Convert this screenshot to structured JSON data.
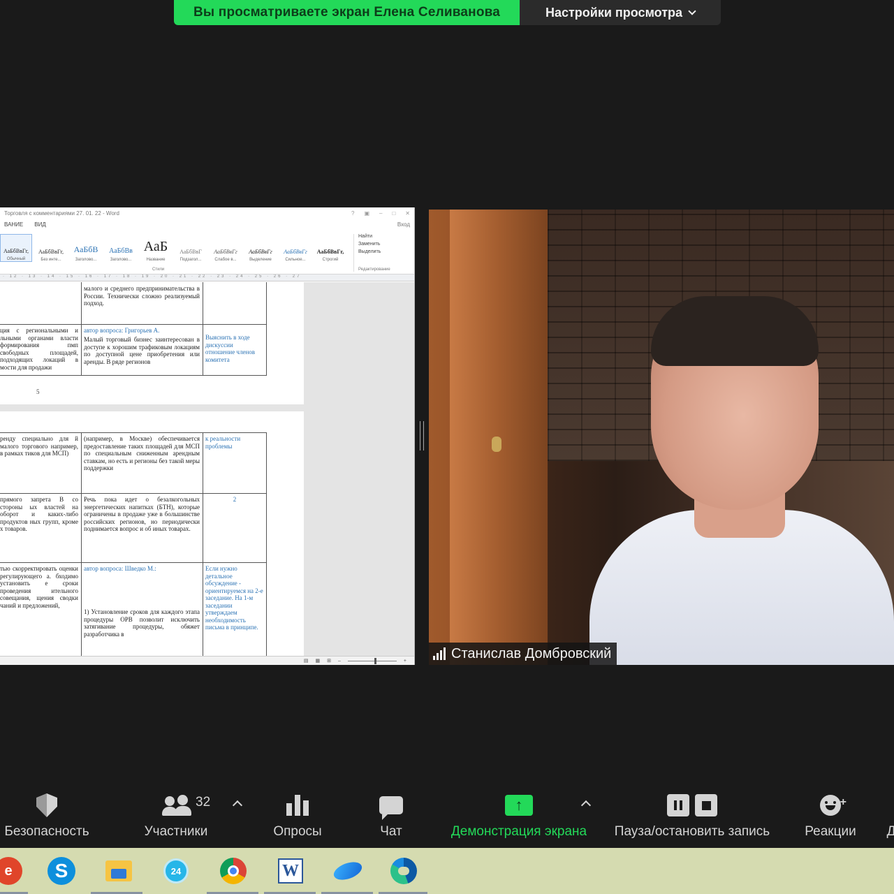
{
  "banner": {
    "viewing_text": "Вы просматриваете экран Елена Селиванова",
    "view_options": "Настройки просмотра"
  },
  "shared_screen": {
    "window_title": "Торговля с комментариями 27. 01. 22 - Word",
    "menu": [
      "ВАНИЕ",
      "ВИД"
    ],
    "menu_right": "Вход",
    "styles": [
      {
        "sample": "АаБбВвГг,",
        "name": "Обычный"
      },
      {
        "sample": "АаБбВвГг,",
        "name": "Без инте..."
      },
      {
        "sample": "АаБбВ",
        "name": "Заголово..."
      },
      {
        "sample": "АаБбВв",
        "name": "Заголово..."
      },
      {
        "sample": "АаБ",
        "name": "Название"
      },
      {
        "sample": "АаБбВвГ",
        "name": "Подзагол..."
      },
      {
        "sample": "АаБбВвГг",
        "name": "Слабое в..."
      },
      {
        "sample": "АаБбВвГг",
        "name": "Выделение"
      },
      {
        "sample": "АаБбВвГг",
        "name": "Сильное..."
      },
      {
        "sample": "АаБбВвГг,",
        "name": "Строгий"
      }
    ],
    "styles_group": "Стили",
    "editing": {
      "find": "Найти",
      "replace": "Заменить",
      "select": "Выделить",
      "group": "Редактирование"
    },
    "ruler": "· 12 · 13 · 14 · 15 · 16 · 17 · 18 · 19 · 20 · 21 · 22 · 23 · 24 · 25 · 26 · 27",
    "page1": {
      "row1_mid": "малого и среднего предпринимательства в России. Технически сложно реализуемый подход.",
      "row2_left": "ция с региональными и льными органами власти формирования пмп свободных площадей, подходящих локаций в мости для продажи",
      "row2_author": "автор вопроса: Григорьев А.",
      "row2_mid": "Малый торговый бизнес заинтересован в доступе к хорошим трафиковым локациям по доступной цене приобретения или аренды. В ряде регионов",
      "row2_right": "Выяснить в ходе дискуссии отношение членов комитета",
      "page_number": "5"
    },
    "page2": {
      "row1_left": "ренду специально для й малого торгового например, в рамках тиков для МСП)",
      "row1_mid": "(например, в Москве) обеспечивается предоставление таких площадей для МСП по специальным сниженным арендным ставкам, но есть и регионы без такой меры поддержки",
      "row1_right": "к реальности проблемы",
      "row2_left": "прямого запрета В со стороны ых властей на оборот и каких-либо продуктов ных групп, кроме х товаров.",
      "row2_mid": "Речь пока идет о безалкогольных энергетических напитках (БТН), которые ограничены в продаже уже в большинстве российских регионов, но периодически поднимается вопрос и об иных товарах.",
      "row2_right": "2",
      "row3_left": "тью скорректировать оценки регулирующего а. бходимо установить е сроки проведения ительного совещания, щения сводки чаний и предложений,",
      "row3_author": "автор вопроса: Шведко М.:",
      "row3_mid": "1) Установление сроков для каждого этапа процедуры ОРВ позволит исключить затягивание процедуры, обяжет разработчика в",
      "row3_right": "Если нужно детальное обсуждение - ориентируемся на 2-е заседание. На 1-м заседании утверждаем необходимость письма в принципе."
    }
  },
  "participant": {
    "name": "Станислав Домбровский"
  },
  "toolbar": {
    "security": "Безопасность",
    "participants": "Участники",
    "participants_count": "32",
    "polls": "Опросы",
    "chat": "Чат",
    "share_screen": "Демонстрация экрана",
    "record": "Пауза/остановить запись",
    "reactions": "Реакции",
    "cut_off": "Д"
  },
  "taskbar": {
    "apps": [
      "red-app-icon",
      "skype-icon",
      "file-explorer-icon",
      "bitrix24-icon",
      "chrome-icon",
      "word-icon",
      "zoom-icon",
      "edge-icon"
    ],
    "bitrix_label": "24",
    "word_label": "W",
    "skype_label": "S"
  },
  "colors": {
    "accent_green": "#23d959",
    "toolbar_bg": "#1a1a1a",
    "taskbar_bg": "#d5dbb0",
    "word_link_blue": "#2e74b5"
  }
}
